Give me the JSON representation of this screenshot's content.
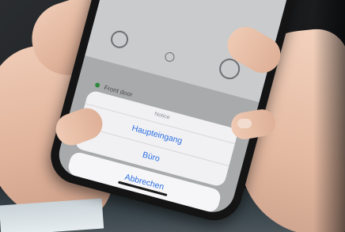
{
  "action_sheet": {
    "title": "Notice",
    "options": [
      "Haupteingang",
      "Büro"
    ],
    "cancel_label": "Abbrechen"
  },
  "background_row": {
    "label": "Front door"
  },
  "icons": [
    "key-icon",
    "settings-icon",
    "phone-call-icon"
  ],
  "colors": {
    "accent": "#2b6ee0",
    "sheet_background": "#f4f4f6",
    "status_dot": "#2e8a3f"
  }
}
